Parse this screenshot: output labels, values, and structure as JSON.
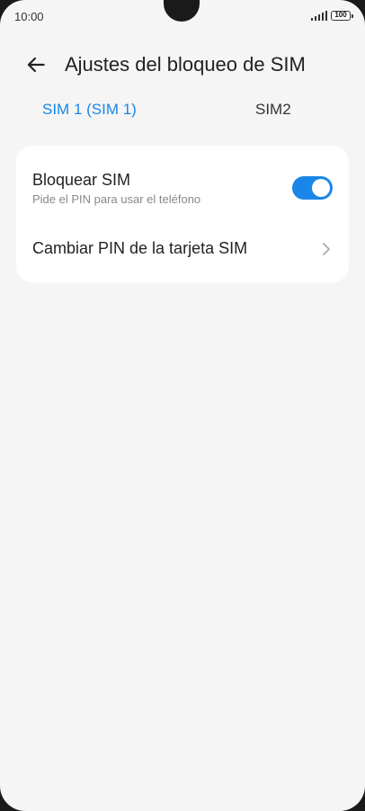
{
  "status_bar": {
    "time": "10:00",
    "battery": "100"
  },
  "header": {
    "back_icon": "arrow-left-icon",
    "title": "Ajustes del bloqueo de SIM"
  },
  "tabs": [
    {
      "label": "SIM 1 (SIM 1)",
      "selected": true
    },
    {
      "label": "SIM2",
      "selected": false
    }
  ],
  "settings": {
    "lock_sim": {
      "title": "Bloquear SIM",
      "subtitle": "Pide el PIN para usar el teléfono",
      "enabled": true
    },
    "change_pin": {
      "title": "Cambiar PIN de la tarjeta SIM",
      "icon": "chevron-right-icon"
    }
  },
  "colors": {
    "accent": "#1a86e8",
    "background": "#f5f5f5",
    "card": "#ffffff"
  }
}
